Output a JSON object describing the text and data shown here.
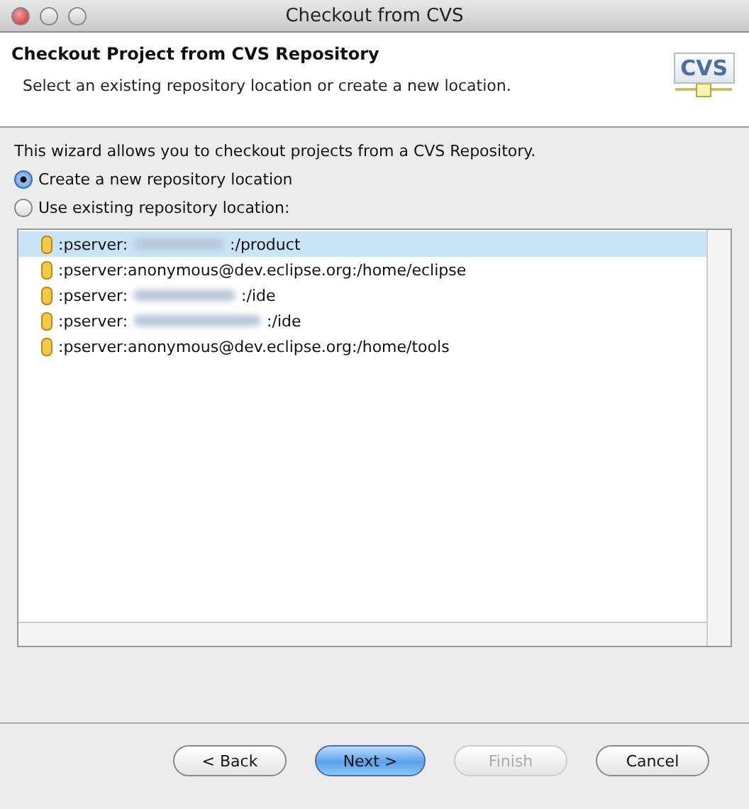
{
  "window": {
    "title": "Checkout from CVS"
  },
  "header": {
    "title": "Checkout Project from CVS Repository",
    "description": "Select an existing repository location or create a new location.",
    "logo": "CVS"
  },
  "intro": "This wizard allows you to checkout projects from a CVS Repository.",
  "options": [
    {
      "label": "Create a new repository location",
      "selected": true
    },
    {
      "label": "Use existing repository location:",
      "selected": false
    }
  ],
  "locations": [
    {
      "prefix": ":pserver:",
      "redacted": true,
      "suffix": ":/product",
      "selected": true
    },
    {
      "prefix": ":pserver:anonymous@dev.eclipse.org:/home/eclipse",
      "redacted": false,
      "selected": false
    },
    {
      "prefix": ":pserver:",
      "redacted": true,
      "suffix": ":/ide",
      "selected": false
    },
    {
      "prefix": ":pserver:",
      "redacted": true,
      "suffix": ":/ide",
      "selected": false
    },
    {
      "prefix": ":pserver:anonymous@dev.eclipse.org:/home/tools",
      "redacted": false,
      "selected": false
    }
  ],
  "buttons": [
    {
      "label": "< Back",
      "default": false,
      "disabled": false
    },
    {
      "label": "Next >",
      "default": true,
      "disabled": false
    },
    {
      "label": "Finish",
      "default": false,
      "disabled": true
    },
    {
      "label": "Cancel",
      "default": false,
      "disabled": false
    }
  ]
}
